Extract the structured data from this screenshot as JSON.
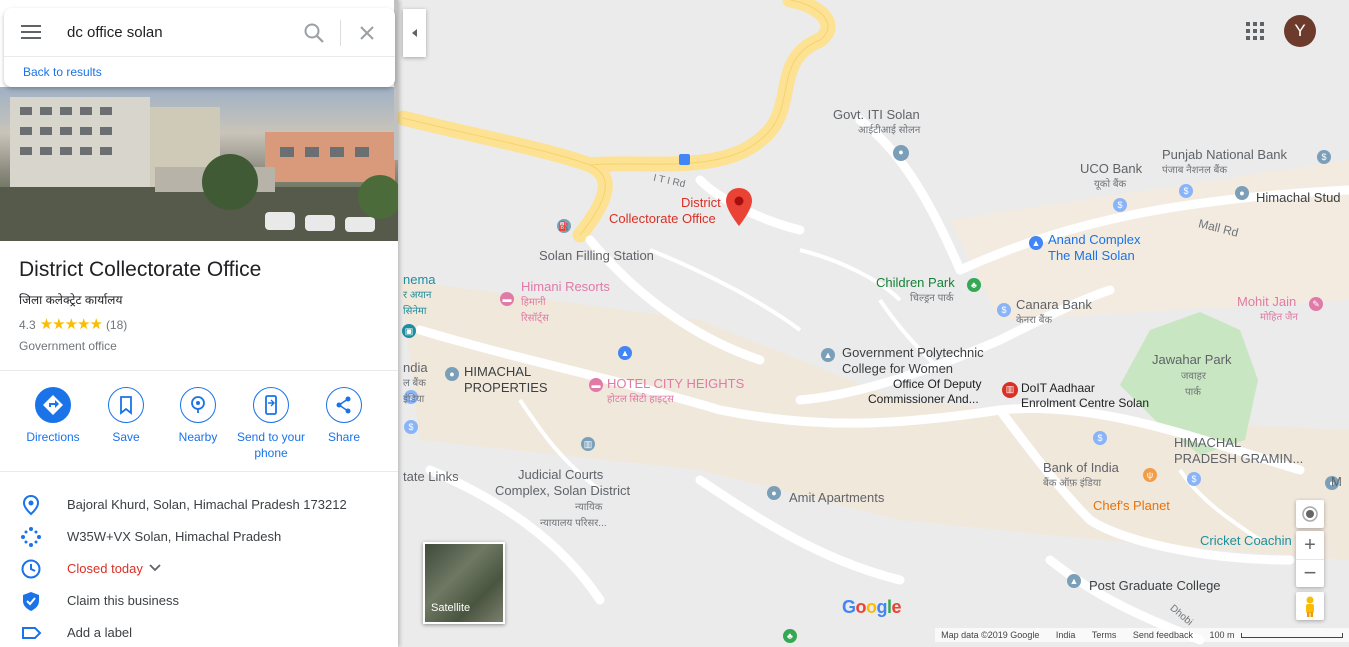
{
  "search": {
    "query": "dc office solan",
    "back": "Back to results"
  },
  "place": {
    "name": "District Collectorate Office",
    "name_local": "जिला कलेक्ट्रेट कार्यालय",
    "rating": "4.3",
    "stars": "★★★★★",
    "reviews": "(18)",
    "category": "Government office"
  },
  "actions": [
    {
      "label": "Directions"
    },
    {
      "label": "Save"
    },
    {
      "label": "Nearby"
    },
    {
      "label": "Send to your phone"
    },
    {
      "label": "Share"
    }
  ],
  "info": {
    "address": "Bajoral Khurd, Solan, Himachal Pradesh 173212",
    "plus_code": "W35W+VX Solan, Himachal Pradesh",
    "hours": "Closed today",
    "claim": "Claim this business",
    "label": "Add a label"
  },
  "map": {
    "labels": {
      "govt_iti": "Govt. ITI Solan",
      "govt_iti_local": "आईटीआई सोलन",
      "iti_rd": "I T I Rd",
      "district_1": "District",
      "district_2": "Collectorate Office",
      "solan_filling": "Solan Filling Station",
      "uco": "UCO Bank",
      "uco_local": "यूको बैंक",
      "pnb": "Punjab National Bank",
      "pnb_local": "पंजाब नैशनल बैंक",
      "himachal_stud": "Himachal Stud",
      "mall_rd": "Mall Rd",
      "anand_1": "Anand Complex",
      "anand_2": "The Mall Solan",
      "children_park": "Children Park",
      "children_park_local": "चिल्ड्रन पार्क",
      "canara": "Canara Bank",
      "canara_local": "केनरा बैंक",
      "mohit": "Mohit Jain",
      "mohit_local": "मोहित जैन",
      "himani": "Himani Resorts",
      "himani_local_1": "हिमानी",
      "himani_local_2": "रिसॉर्ट्स",
      "nema": "nema",
      "nema_local_1": "र अयान",
      "nema_local_2": "सिनेमा",
      "india_l": "ndia",
      "india_l_local_1": "ल बैंक",
      "india_l_local_2": "इंडिया",
      "himachal_prop_1": "HIMACHAL",
      "himachal_prop_2": "PROPERTIES",
      "hotel": "HOTEL CITY HEIGHTS",
      "hotel_local": "होटल सिटी हाइट्स",
      "polytech_1": "Government Polytechnic",
      "polytech_2": "College for Women",
      "deputy_1": "Office Of Deputy",
      "deputy_2": "Commissioner And...",
      "doit_1": "DoIT Aadhaar",
      "doit_2": "Enrolment Centre Solan",
      "jawahar": "Jawahar Park",
      "jawahar_local_1": "जवाहर",
      "jawahar_local_2": "पार्क",
      "state_links": "tate Links",
      "judicial_1": "Judicial Courts",
      "judicial_2": "Complex, Solan District",
      "judicial_local_1": "न्यायिक",
      "judicial_local_2": "न्यायालय परिसर...",
      "amit": "Amit Apartments",
      "boi": "Bank of India",
      "boi_local": "बैंक ऑफ़ इंडिया",
      "hp_gramin_1": "HIMACHAL",
      "hp_gramin_2": "PRADESH GRAMIN...",
      "chefs": "Chef's Planet",
      "cricket": "Cricket Coachin",
      "pgc": "Post Graduate College",
      "dhobi": "Dhobi",
      "m_edge": "M"
    },
    "satellite": "Satellite",
    "google": "Google",
    "user_initial": "Y",
    "footer": {
      "data": "Map data ©2019 Google",
      "india": "India",
      "terms": "Terms",
      "feedback": "Send feedback",
      "scale": "100 m"
    }
  },
  "colors": {
    "accent": "#1a73e8",
    "closed": "#d93025",
    "pin": "#ea4335",
    "road_yellow": "#fde293",
    "park": "#c8e6c1",
    "avatar": "#6d3b2c"
  }
}
